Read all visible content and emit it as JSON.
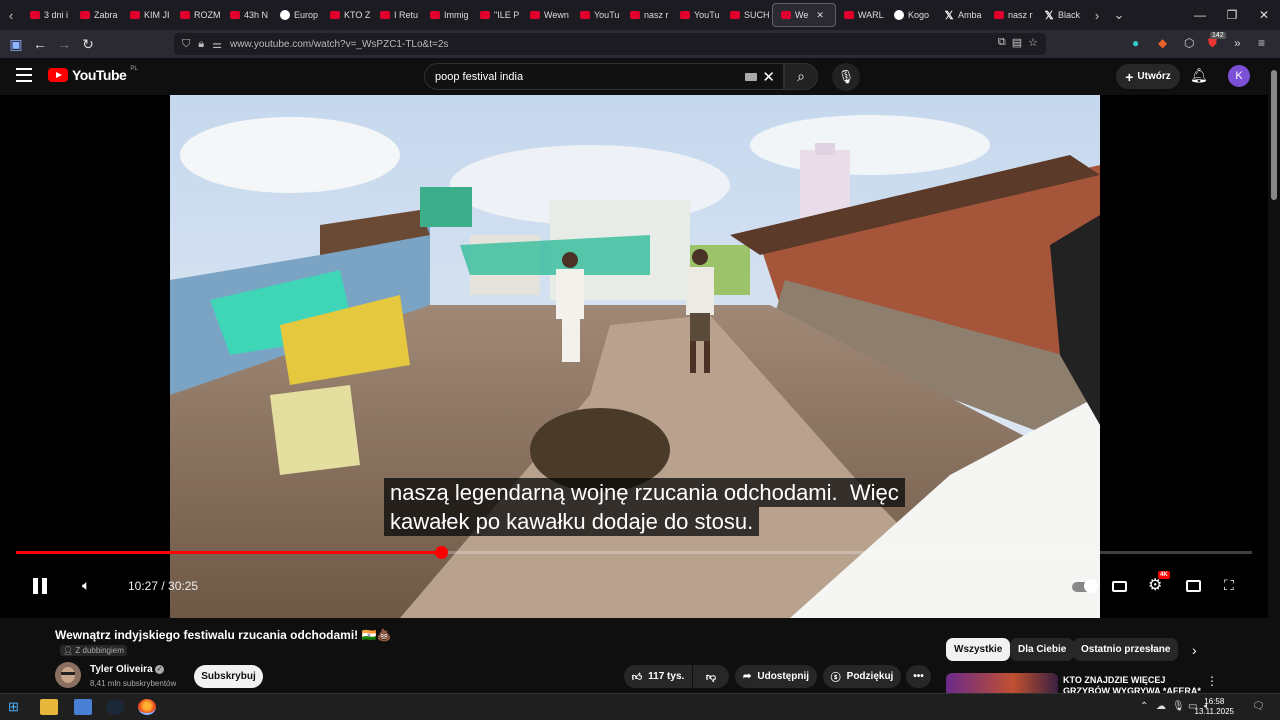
{
  "browser": {
    "tabs": [
      {
        "label": "3 dni i",
        "icon": "youtube-icon"
      },
      {
        "label": "Zabra",
        "icon": "youtube-icon"
      },
      {
        "label": "KIM JI",
        "icon": "youtube-icon"
      },
      {
        "label": "ROZM",
        "icon": "youtube-icon"
      },
      {
        "label": "43h N",
        "icon": "youtube-icon"
      },
      {
        "label": "Europ",
        "icon": "globe-icon"
      },
      {
        "label": "KTO Z",
        "icon": "youtube-icon"
      },
      {
        "label": "I Retu",
        "icon": "youtube-icon"
      },
      {
        "label": "Immig",
        "icon": "youtube-icon"
      },
      {
        "label": "\"ILE P",
        "icon": "youtube-icon"
      },
      {
        "label": "Wewn",
        "icon": "youtube-icon"
      },
      {
        "label": "YouTu",
        "icon": "youtube-icon"
      },
      {
        "label": "nasz r",
        "icon": "youtube-icon"
      },
      {
        "label": "YouTu",
        "icon": "youtube-icon"
      },
      {
        "label": "SUCH",
        "icon": "youtube-icon"
      },
      {
        "label": "We",
        "icon": "youtube-icon",
        "active": true
      },
      {
        "label": "WARL",
        "icon": "youtube-icon"
      },
      {
        "label": "Kogo",
        "icon": "globe-icon"
      },
      {
        "label": "Amba",
        "icon": "x-icon"
      },
      {
        "label": "nasz r",
        "icon": "youtube-icon"
      },
      {
        "label": "Black",
        "icon": "x-icon"
      }
    ],
    "url": "www.youtube.com/watch?v=_WsPZC1-TLo&t=2s",
    "notification_count": "142"
  },
  "youtube": {
    "logo_text": "YouTube",
    "country_code": "PL",
    "search_value": "poop festival india",
    "create_label": "Utwórz",
    "avatar_letter": "K"
  },
  "player": {
    "subtitle_line1": "naszą legendarną wojnę rzucania odchodami.  Więc",
    "subtitle_line2": "kawałek po kawałku dodaje do stosu.",
    "current_time": "10:27",
    "duration": "30:25",
    "time_display": "10:27 / 30:25",
    "progress_fraction": 0.3436,
    "quality_badge": "4K",
    "state": "playing"
  },
  "video": {
    "title": "Wewnątrz indyjskiego festiwalu rzucania odchodami! 🇮🇳💩",
    "dubbing_label": "Z dubbingiem",
    "channel_name": "Tyler Oliveira",
    "subscribers": "8,41 mln subskrybentów",
    "subscribe_label": "Subskrybuj",
    "likes": "117 tys.",
    "share_label": "Udostępnij",
    "thanks_label": "Podziękuj"
  },
  "recommendations": {
    "chips": [
      "Wszystkie",
      "Dla Ciebie",
      "Ostatnio przesłane"
    ],
    "selected_chip": "Wszystkie",
    "first_title": "KTO ZNAJDZIE WIĘCEJ GRZYBÓW WYGRYWA *AFERA*"
  },
  "taskbar": {
    "time": "16:58",
    "date": "13.11.2025"
  },
  "colors": {
    "youtube_red": "#ff0000",
    "background": "#0f0f0f",
    "avatar_purple": "#7b4fd6"
  }
}
